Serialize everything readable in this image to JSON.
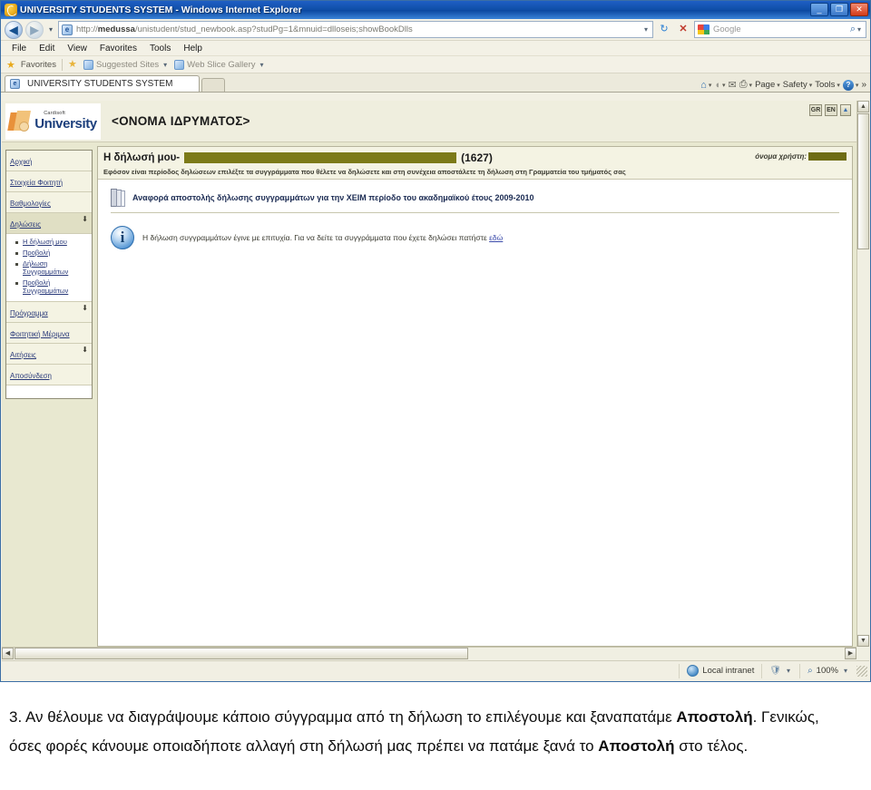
{
  "browser": {
    "window_title": "UNIVERSITY STUDENTS SYSTEM - Windows Internet Explorer",
    "window_controls": {
      "minimize": "_",
      "restore": "❐",
      "close": "✕"
    },
    "address": {
      "url_prefix": "http://",
      "url_host": "medussa",
      "url_rest": "/unistudent/stud_newbook.asp?studPg=1&mnuid=dlloseis;showBookDlls",
      "dropdown_caret": "▾",
      "refresh_icon": "↻",
      "stop_icon": "✕"
    },
    "search": {
      "placeholder": "Google",
      "engine_icon": "google-icon",
      "go_icon": "⌕",
      "caret": "▾"
    },
    "nav": {
      "back": "◀",
      "forward": "▶",
      "recent_caret": "▾"
    },
    "menus": [
      "File",
      "Edit",
      "View",
      "Favorites",
      "Tools",
      "Help"
    ],
    "favorites_bar": {
      "favorites_label": "Favorites",
      "items": [
        "Suggested Sites",
        "Web Slice Gallery"
      ],
      "caret": "▾"
    },
    "tabs": [
      {
        "label": "UNIVERSITY STUDENTS SYSTEM",
        "active": true
      }
    ],
    "new_tab_label": "",
    "command_bar": {
      "items": [
        "Page",
        "Safety",
        "Tools"
      ],
      "caret": "▾",
      "overflow": "»",
      "help_glyph": "?"
    },
    "status_bar": {
      "zone": "Local intranet",
      "zoom": "100%",
      "caret": "▾"
    }
  },
  "site": {
    "logo": {
      "brand_small": "Cardisoft",
      "brand_main": "University"
    },
    "institution_name": "<ΟΝΟΜΑ ΙΔΡΥΜΑΤΟΣ>",
    "languages": [
      "GR",
      "EN"
    ],
    "collapse_glyph": "▲"
  },
  "sidebar": {
    "items": [
      {
        "label": "Αρχική",
        "expandable": false,
        "active": false
      },
      {
        "label": "Στοιχεία Φοιτητή",
        "expandable": false,
        "active": false
      },
      {
        "label": "Βαθμολογίες",
        "expandable": false,
        "active": false
      },
      {
        "label": "Δηλώσεις",
        "expandable": true,
        "active": true
      },
      {
        "label": "Πρόγραμμα",
        "expandable": true,
        "active": false
      },
      {
        "label": "Φοιτητική Μέριμνα",
        "expandable": false,
        "active": false
      },
      {
        "label": "Αιτήσεις",
        "expandable": true,
        "active": false
      },
      {
        "label": "Αποσύνδεση",
        "expandable": false,
        "active": false
      }
    ],
    "submenu": [
      "Η δήλωσή μου",
      "Προβολή",
      "Δήλωση Συγγραμμάτων",
      "Προβολή Συγγραμμάτων"
    ],
    "expander_glyph": "⬇"
  },
  "main": {
    "title": "Η δήλωσή μου-",
    "count": "(1627)",
    "redacted_title_value": "",
    "user_label": "όνομα χρήστη:",
    "user_value_redacted": "",
    "subtitle": "Εφόσον είναι περίοδος δηλώσεων επιλέξτε τα συγγράμματα που θέλετε να δηλώσετε και στη συνέχεια αποστάλετε τη δήλωση στη Γραμματεία του τμήματός σας",
    "report_heading": "Αναφορά αποστολής δήλωσης συγγραμμάτων για την ΧΕΙΜ περίοδο του ακαδημαϊκού έτους 2009-2010",
    "info_message_before": "Η δήλωση συγγραμμάτων έγινε με επιτυχία.  Για να δείτε τα συγγράμματα που έχετε δηλώσει πατήστε ",
    "info_link": "εδώ",
    "info_icon_glyph": "i"
  },
  "caption": {
    "line1_prefix": "3. Αν θέλουμε να διαγράψουμε κάποιο σύγγραμμα από τη δήλωση το επιλέγουμε και ξαναπατάμε ",
    "bold1": "Αποστολή",
    "line1_suffix": ". Γενικώς, όσες φορές κάνουμε οποιαδήποτε αλλαγή στη δήλωσή μας πρέπει να πατάμε ξανά το ",
    "bold2": "Αποστολή",
    "line1_end": " στο τέλος."
  }
}
